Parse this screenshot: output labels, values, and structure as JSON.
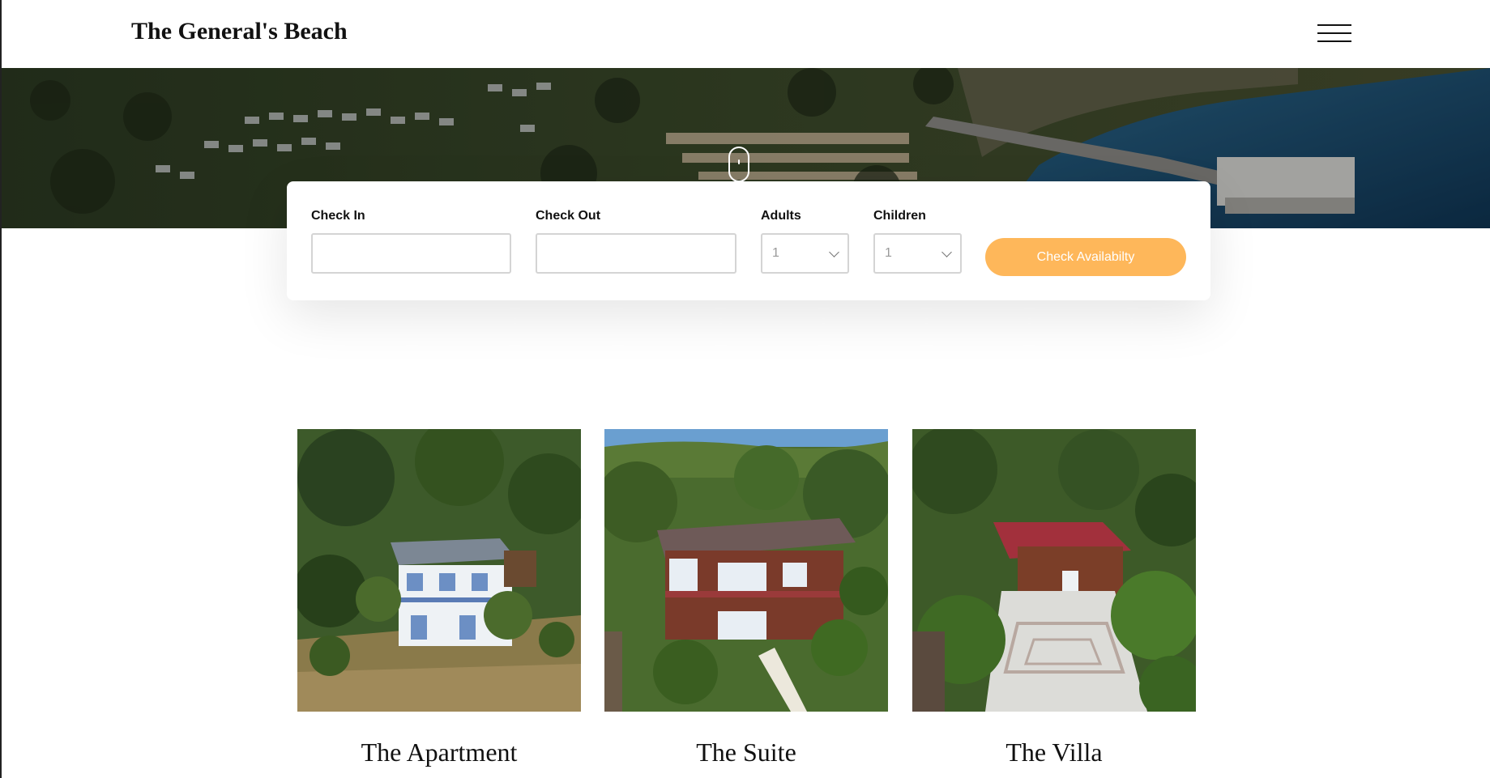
{
  "header": {
    "brand": "The General's Beach",
    "menu_icon": "hamburger-menu-icon"
  },
  "hero": {
    "scroll_icon": "scroll-mouse-icon"
  },
  "booking": {
    "check_in": {
      "label": "Check In",
      "value": ""
    },
    "check_out": {
      "label": "Check Out",
      "value": ""
    },
    "adults": {
      "label": "Adults",
      "selected": "1"
    },
    "children": {
      "label": "Children",
      "selected": "1"
    },
    "submit_label": "Check Availabilty",
    "accent_color": "#feb75a"
  },
  "rooms": [
    {
      "title": "The Apartment"
    },
    {
      "title": "The Suite"
    },
    {
      "title": "The Villa"
    }
  ]
}
